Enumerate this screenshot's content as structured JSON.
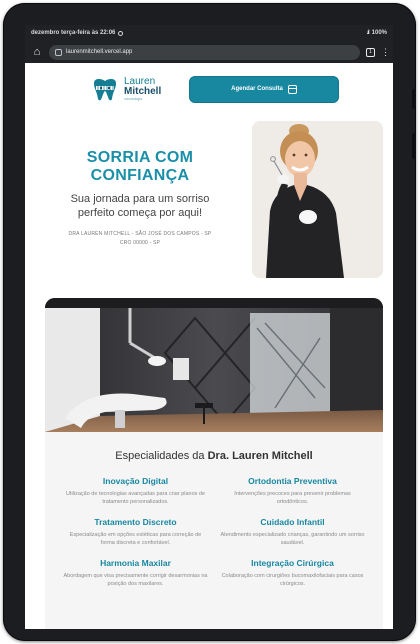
{
  "statusbar": {
    "datetime": "dezembro terça-feira às 22:06",
    "battery": "100%"
  },
  "browser": {
    "url": "laurenmitchell.vercel.app",
    "tab_count": "1",
    "icons": [
      "home-icon",
      "site-info-icon",
      "tabs-icon",
      "menu-icon"
    ]
  },
  "header": {
    "logo_first": "Lauren",
    "logo_last": "Mitchell",
    "logo_sub": "odontologia",
    "cta_label": "Agendar Consulta"
  },
  "hero": {
    "title_line1": "SORRIA COM",
    "title_line2": "CONFIANÇA",
    "subtitle_line1": "Sua jornada para um sorriso",
    "subtitle_line2": "perfeito começa por aqui!",
    "meta_line1": "DRA LAUREN MITCHELL - SÃO JOSÉ DOS CAMPOS - SP",
    "meta_line2": "CRO 00000 - SP"
  },
  "specialties": {
    "heading_prefix": "Especialidades da",
    "heading_name": "Dra. Lauren Mitchell",
    "items": [
      {
        "title": "Inovação Digital",
        "desc": "Utilização de tecnologias avançadas para criar planos de tratamento personalizados."
      },
      {
        "title": "Ortodontia Preventiva",
        "desc": "Intervenções precoces para prevenir problemas ortodônticos."
      },
      {
        "title": "Tratamento Discreto",
        "desc": "Especialização em opções estéticas para correção de forma discreta e confortável."
      },
      {
        "title": "Cuidado Infantil",
        "desc": "Atendimento especializado crianças, garantindo um sorriso saudável."
      },
      {
        "title": "Harmonia Maxilar",
        "desc": "Abordagem que visa precisamente corrigir desarmonias na posição dos maxilares."
      },
      {
        "title": "Integração Cirúrgica",
        "desc": "Colaboração com cirurgiões bucomaxilofaciais para casos cirúrgicos."
      }
    ]
  },
  "colors": {
    "brand": "#1a8fa8",
    "brand_dark": "#1b4f6b",
    "button": "#1887a0",
    "browser_chrome": "#202124"
  }
}
